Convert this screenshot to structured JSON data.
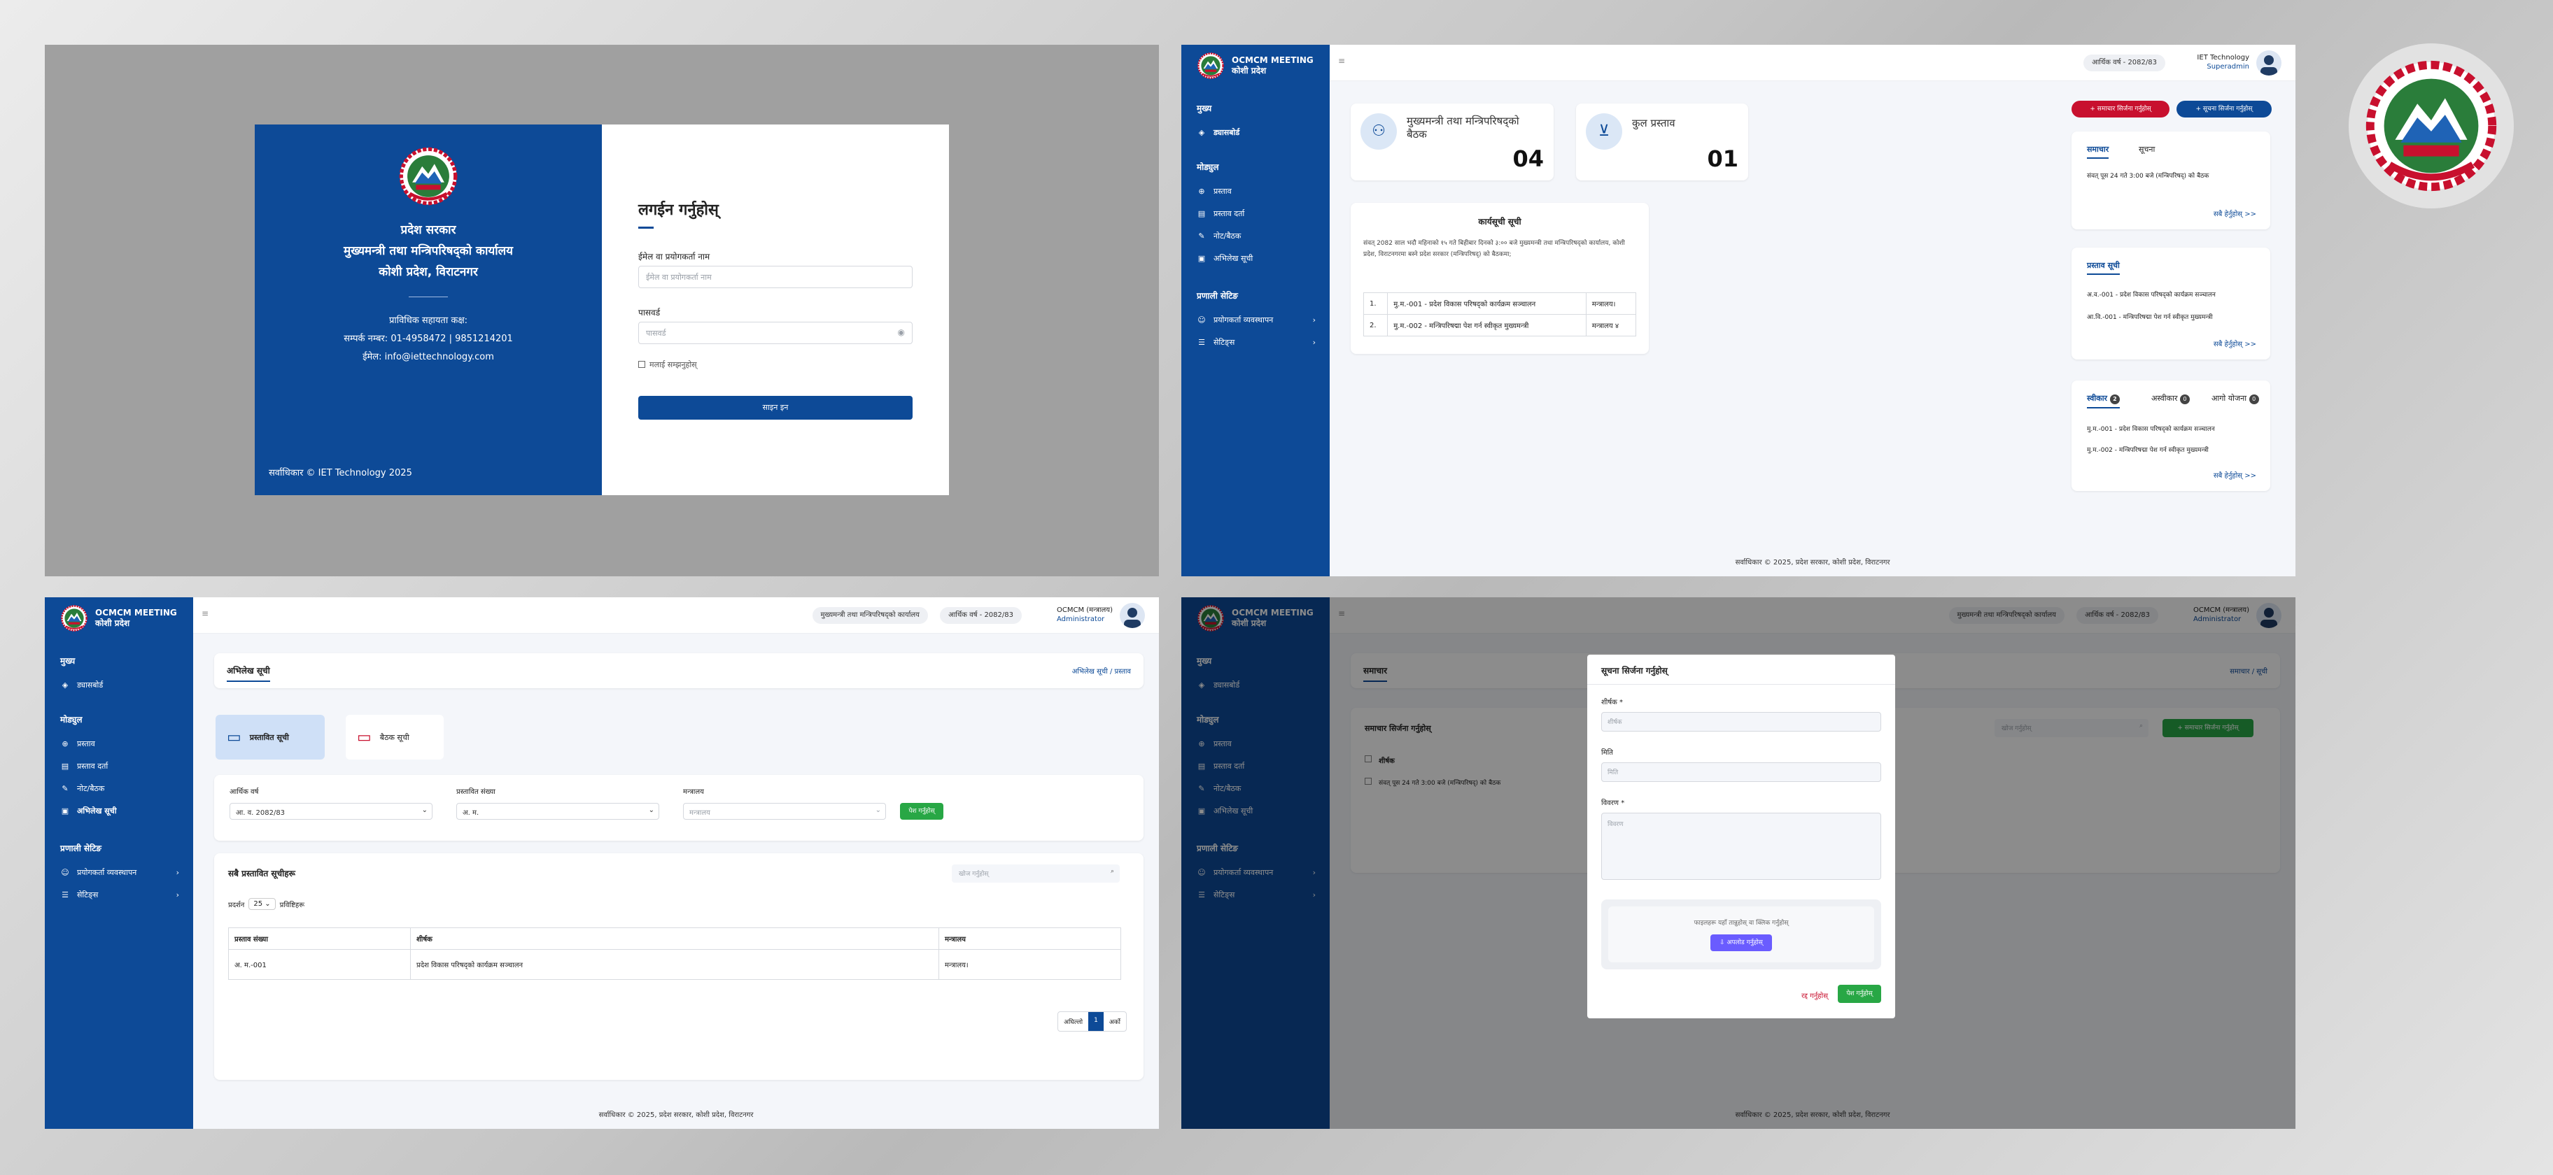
{
  "login": {
    "left": {
      "line1": "प्रदेश सरकार",
      "line2": "मुख्यमन्त्री तथा मन्त्रिपरिषद्को कार्यालय",
      "line3": "कोशी प्रदेश, विराटनगर",
      "help_title": "प्राविधिक सहायता कक्ष:",
      "help_phone": "सम्पर्क नम्बर: 01-4958472 | 9851214201",
      "help_email": "ईमेल: info@iettechnology.com",
      "copyright": "सर्वाधिकार © IET Technology 2025"
    },
    "right": {
      "title": "लगईन गर्नुहोस्",
      "email_label": "ईमेल वा प्रयोगकर्ता नाम",
      "email_placeholder": "ईमेल वा प्रयोगकर्ता नाम",
      "password_label": "पासवर्ड",
      "password_placeholder": "पासवर्ड",
      "remember_label": "मलाई सम्झनुहोस्",
      "submit_label": "साइन इन"
    }
  },
  "shell": {
    "brand_title": "OCMCM MEETING",
    "brand_sub": "कोशी प्रदेश",
    "sec_main": "मुख्य",
    "item_dashboard": "ड्यासबोर्ड",
    "sec_modules": "मोड्युल",
    "item_proposal": "प्रस्ताव",
    "item_proposal_list": "प्रस्ताव दर्ता",
    "item_notes": "नोट/बैठक",
    "item_records": "अभिलेख सूची",
    "sec_system": "प्रणाली सेटिङ",
    "item_users": "प्रयोगकर्ता व्यवस्थापन",
    "item_settings": "सेटिङ्स",
    "fiscal_year": "आर्थिक वर्ष - 2082/83",
    "office_pill": "मुख्यमन्त्री तथा मन्त्रिपरिषद्को कार्यालय",
    "footer": "सर्वाधिकार © 2025, प्रदेश सरकार, कोशी प्रदेश, विराटनगर"
  },
  "dashboard": {
    "user_name": "IET Technology",
    "user_role": "Superadmin",
    "stat1_label": "मुख्यमन्त्री तथा मन्त्रिपरिषद्को बैठक",
    "stat1_value": "04",
    "stat2_label": "कुल प्रस्ताव",
    "stat2_value": "01",
    "btn_news": "+ समाचार सिर्जना गर्नुहोस्",
    "btn_notice": "+ सूचना सिर्जना गर्नुहोस्",
    "agenda_title": "कार्यसूची सूची",
    "agenda_text": "संवत् 2082 साल भदौ महिनाको १५ गते बिहीबार दिनको ३:०० बजे मुख्यमन्त्री तथा मन्त्रिपरिषद्को कार्यालय, कोशी प्रदेश, विराटनगरमा बस्ने प्रदेश सरकार (मन्त्रिपरिषद्) को बैठकमा;",
    "agenda_rows": [
      {
        "sn": "1.",
        "title": "मु.म.-001 - प्रदेश विकास परिषद्को कार्यक्रम सञ्चालन",
        "ministry": "मन्त्रालय।"
      },
      {
        "sn": "2.",
        "title": "मु.म.-002 - मन्त्रिपरिषद्मा पेश गर्न स्वीकृत मुख्यमन्त्री",
        "ministry": "मन्त्रालय ४"
      }
    ],
    "tab_news": "समाचार",
    "tab_notice": "सूचना",
    "news_item": "संवत् पूस 24 गते 3:00 बजे (मन्त्रिपरिषद्) को बैठक",
    "view_all": "सबै हेर्नुहोस् >>",
    "proposal_title": "प्रस्ताव सूची",
    "proposal_items": [
      "अ.व.-001 - प्रदेश विकास परिषद्को कार्यक्रम सञ्चालन",
      "आ.वि.-001 - मन्त्रिपरिषद्मा पेश गर्न स्वीकृत मुख्यमन्त्री"
    ],
    "status_tabs": [
      "स्वीकार",
      "अस्वीकार",
      "आगो योजना"
    ],
    "status_counts": [
      "2",
      "0",
      "0"
    ],
    "status_items": [
      "मु.म.-001 - प्रदेश विकास परिषद्को कार्यक्रम सञ्चालन",
      "मु.म.-002 - मन्त्रिपरिषद्मा पेश गर्न स्वीकृत मुख्यमन्त्री"
    ]
  },
  "records": {
    "user_name": "OCMCM (मन्त्रालय)",
    "user_role": "Administrator",
    "page_title": "अभिलेख सूची",
    "crumb": "अभिलेख सूची / प्रस्ताव",
    "tab1": "प्रस्तावित सूची",
    "tab2": "बैठक सूची",
    "f_year_label": "आर्थिक वर्ष",
    "f_year_value": "आ. व. 2082/83",
    "f_no_label": "प्रस्तावित संख्या",
    "f_no_value": "अ. म.",
    "f_min_label": "मन्त्रालय",
    "f_min_value": "मन्त्रालय",
    "f_submit": "पेश गर्नुहोस्",
    "list_title": "सबै प्रस्तावित सूचीहरू",
    "search_placeholder": "खोज गर्नुहोस्",
    "show_label": "प्रदर्शन",
    "show_value": "25",
    "show_suffix": "प्रविष्टिहरू",
    "col1": "प्रस्ताव संख्या",
    "col2": "शीर्षक",
    "col3": "मन्त्रालय",
    "row": {
      "no": "अ. म.-001",
      "title": "प्रदेश विकास परिषद्को कार्यक्रम सञ्चालन",
      "ministry": "मन्त्रालय।"
    },
    "prev": "अघिल्लो",
    "page": "1",
    "next": "अर्को"
  },
  "news_modal": {
    "page_title": "समाचार",
    "crumb": "समाचार / सूची",
    "list_title": "समाचार सिर्जना गर्नुहोस्",
    "search_placeholder": "खोज गर्नुहोस्",
    "create_btn": "+ समाचार सिर्जना गर्नुहोस्",
    "col_title": "शीर्षक",
    "row_title": "संवत् पूस 24 गते 3:00 बजे (मन्त्रिपरिषद्) को बैठक",
    "modal_title": "सूचना सिर्जना गर्नुहोस्",
    "title_label": "शीर्षक *",
    "title_placeholder": "शीर्षक",
    "date_label": "मिति",
    "date_placeholder": "मिति",
    "desc_label": "विवरण *",
    "desc_placeholder": "विवरण",
    "upload_hint": "फाइलहरू यहाँ तान्नुहोस् वा क्लिक गर्नुहोस्",
    "upload_btn": "अपलोड गर्नुहोस्",
    "cancel": "रद्द गर्नुहोस्",
    "save": "पेश गर्नुहोस्"
  },
  "colors": {
    "primary": "#0d4a97",
    "danger": "#c8102e",
    "success": "#28a745"
  }
}
